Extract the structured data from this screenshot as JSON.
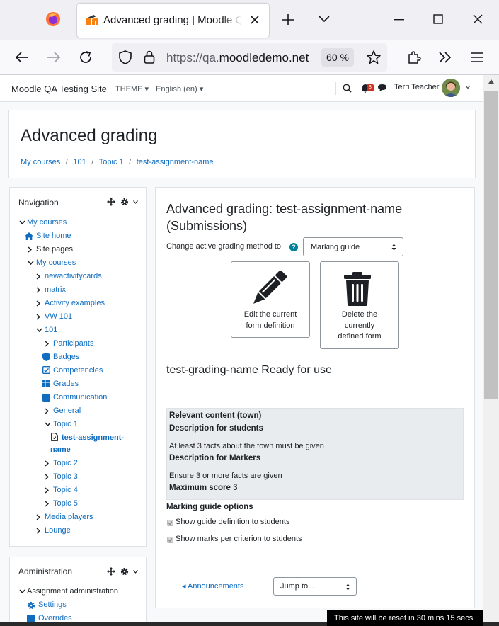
{
  "browser": {
    "tab_title": "Advanced grading | Moodle QA Testing Site",
    "url_prefix": "https://qa.",
    "url_host": "moodledemo.net",
    "zoom": "60 %"
  },
  "header": {
    "site_name": "Moodle QA Testing Site",
    "theme_menu": "THEME",
    "language_menu": "English (en)",
    "notification_count": "3",
    "user_name": "Terri Teacher"
  },
  "page": {
    "title": "Advanced grading",
    "breadcrumb": [
      "My courses",
      "101",
      "Topic 1",
      "test-assignment-name"
    ]
  },
  "navigation": {
    "title": "Navigation",
    "items": [
      {
        "label": "My courses"
      },
      {
        "label": "Site home"
      },
      {
        "label": "Site pages"
      },
      {
        "label": "My courses"
      },
      {
        "label": "newactivitycards"
      },
      {
        "label": "matrix"
      },
      {
        "label": "Activity examples"
      },
      {
        "label": "VW 101"
      },
      {
        "label": "101"
      },
      {
        "label": "Participants"
      },
      {
        "label": "Badges"
      },
      {
        "label": "Competencies"
      },
      {
        "label": "Grades"
      },
      {
        "label": "Communication"
      },
      {
        "label": "General"
      },
      {
        "label": "Topic 1"
      },
      {
        "label": "test-assignment-"
      },
      {
        "label": "name"
      },
      {
        "label": "Topic 2"
      },
      {
        "label": "Topic 3"
      },
      {
        "label": "Topic 4"
      },
      {
        "label": "Topic 5"
      },
      {
        "label": "Media players"
      },
      {
        "label": "Lounge"
      }
    ]
  },
  "administration": {
    "title": "Administration",
    "items": [
      {
        "label": "Assignment administration"
      },
      {
        "label": "Settings"
      },
      {
        "label": "Overrides"
      }
    ]
  },
  "main": {
    "heading_line1": "Advanced grading: test-assignment-name",
    "heading_line2": "(Submissions)",
    "method_label": "Change active grading method to",
    "method_value": "Marking guide",
    "edit_button_line1": "Edit the current",
    "edit_button_line2": "form definition",
    "delete_button_line1": "Delete the",
    "delete_button_line2": "currently",
    "delete_button_line3": "defined form",
    "form_status": "test-grading-name Ready for use",
    "guide": {
      "criterion": "Relevant content (town)",
      "students_heading": "Description for students",
      "students_text": "At least 3 facts about the town must be given",
      "markers_heading": "Description for Markers",
      "markers_text": "Ensure 3 or more facts are given",
      "max_label": "Maximum score",
      "max_value": "3"
    },
    "options_heading": "Marking guide options",
    "option1": "Show guide definition to students",
    "option2": "Show marks per criterion to students",
    "announcements_link": "Announcements",
    "jump_to": "Jump to..."
  },
  "toast": "This site will be reset in 30 mins 15 secs",
  "colors": {
    "link": "#0f6cbf",
    "accent": "#0f6cbf",
    "badge": "#ca3120",
    "firefox_orange": "#ff7139"
  }
}
